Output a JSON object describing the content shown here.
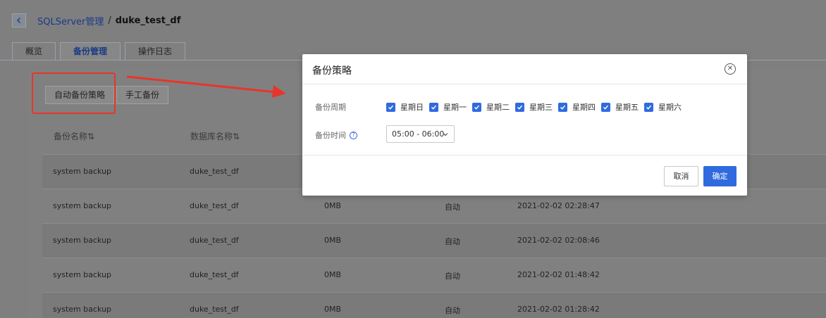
{
  "header": {
    "breadcrumb_parent": "SQLServer管理",
    "separator": "/",
    "breadcrumb_current": "duke_test_df"
  },
  "tabs": [
    {
      "label": "概览",
      "active": false
    },
    {
      "label": "备份管理",
      "active": true
    },
    {
      "label": "操作日志",
      "active": false
    }
  ],
  "toolbar": {
    "auto_backup_label": "自动备份策略",
    "manual_backup_label": "手工备份"
  },
  "table": {
    "columns": [
      "备份名称",
      "数据库名称"
    ],
    "sort_glyph": "⇅",
    "rows": [
      {
        "name": "system backup",
        "db": "duke_test_df",
        "size": "",
        "type": "",
        "time": ""
      },
      {
        "name": "system backup",
        "db": "duke_test_df",
        "size": "0MB",
        "type": "自动",
        "time": "2021-02-02 02:28:47"
      },
      {
        "name": "system backup",
        "db": "duke_test_df",
        "size": "0MB",
        "type": "自动",
        "time": "2021-02-02 02:08:46"
      },
      {
        "name": "system backup",
        "db": "duke_test_df",
        "size": "0MB",
        "type": "自动",
        "time": "2021-02-02 01:48:42"
      },
      {
        "name": "system backup",
        "db": "duke_test_df",
        "size": "0MB",
        "type": "自动",
        "time": "2021-02-02 01:28:42"
      }
    ]
  },
  "modal": {
    "title": "备份策略",
    "cycle_label": "备份周期",
    "weekdays": [
      {
        "label": "星期日",
        "checked": true
      },
      {
        "label": "星期一",
        "checked": true
      },
      {
        "label": "星期二",
        "checked": true
      },
      {
        "label": "星期三",
        "checked": true
      },
      {
        "label": "星期四",
        "checked": true
      },
      {
        "label": "星期五",
        "checked": true
      },
      {
        "label": "星期六",
        "checked": true
      }
    ],
    "time_label": "备份时间",
    "time_value": "05:00 - 06:00",
    "cancel_label": "取消",
    "ok_label": "确定"
  },
  "colors": {
    "accent": "#2f6bde",
    "annotation_red": "#e8352a",
    "link": "#1a3b86"
  }
}
